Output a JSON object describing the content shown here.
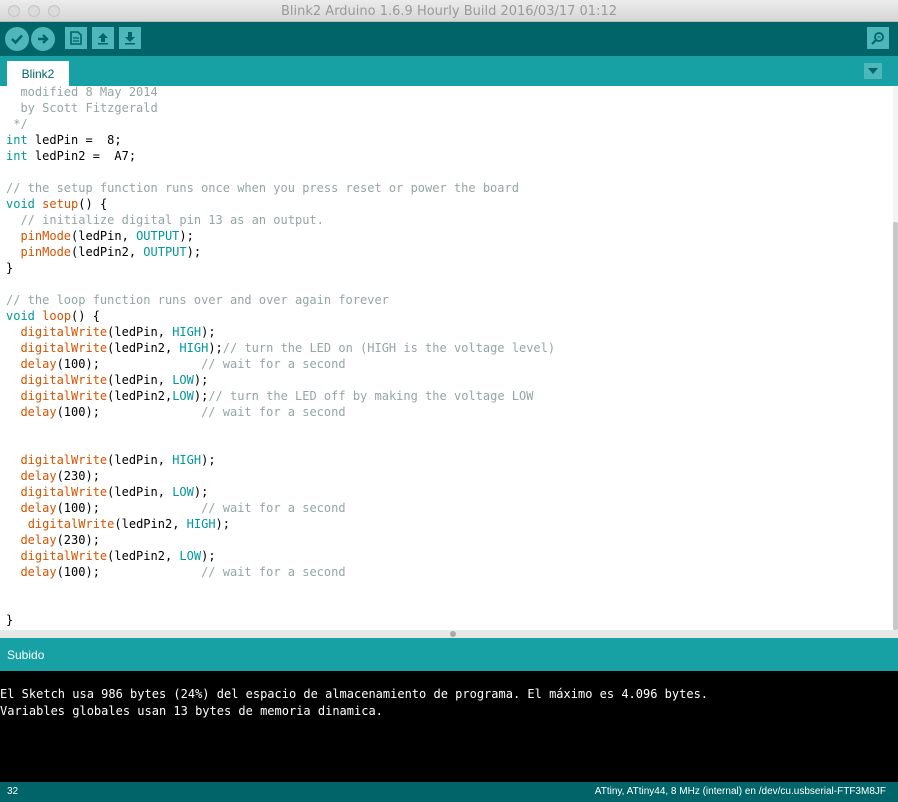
{
  "window": {
    "title": "Blink2 Arduino 1.6.9 Hourly Build 2016/03/17 01:12"
  },
  "toolbar": {
    "verify_icon": "check-icon",
    "upload_icon": "arrow-right-icon",
    "new_icon": "document-icon",
    "open_icon": "upload-icon",
    "save_icon": "download-icon",
    "serial_monitor_icon": "magnifier-icon"
  },
  "tabs": [
    {
      "label": "Blink2"
    }
  ],
  "editor": {
    "lines": [
      [
        {
          "t": "  modified 8 May 2014",
          "c": "com"
        }
      ],
      [
        {
          "t": "  by Scott Fitzgerald",
          "c": "com"
        }
      ],
      [
        {
          "t": " */",
          "c": "com"
        }
      ],
      [
        {
          "t": "int",
          "c": "kw"
        },
        {
          "t": " ledPin =  8;"
        }
      ],
      [
        {
          "t": "int",
          "c": "kw"
        },
        {
          "t": " ledPin2 =  A7;"
        }
      ],
      [],
      [
        {
          "t": "// the setup function runs once when you press reset or power the board",
          "c": "com"
        }
      ],
      [
        {
          "t": "void",
          "c": "kw"
        },
        {
          "t": " "
        },
        {
          "t": "setup",
          "c": "fn"
        },
        {
          "t": "() {"
        }
      ],
      [
        {
          "t": "  // initialize digital pin 13 as an output.",
          "c": "com"
        }
      ],
      [
        {
          "t": "  "
        },
        {
          "t": "pinMode",
          "c": "fn"
        },
        {
          "t": "(ledPin, "
        },
        {
          "t": "OUTPUT",
          "c": "kw"
        },
        {
          "t": ");"
        }
      ],
      [
        {
          "t": "  "
        },
        {
          "t": "pinMode",
          "c": "fn"
        },
        {
          "t": "(ledPin2, "
        },
        {
          "t": "OUTPUT",
          "c": "kw"
        },
        {
          "t": ");"
        }
      ],
      [
        {
          "t": "}"
        }
      ],
      [],
      [
        {
          "t": "// the loop function runs over and over again forever",
          "c": "com"
        }
      ],
      [
        {
          "t": "void",
          "c": "kw"
        },
        {
          "t": " "
        },
        {
          "t": "loop",
          "c": "fn"
        },
        {
          "t": "() {"
        }
      ],
      [
        {
          "t": "  "
        },
        {
          "t": "digitalWrite",
          "c": "fn"
        },
        {
          "t": "(ledPin, "
        },
        {
          "t": "HIGH",
          "c": "kw"
        },
        {
          "t": ");"
        }
      ],
      [
        {
          "t": "  "
        },
        {
          "t": "digitalWrite",
          "c": "fn"
        },
        {
          "t": "(ledPin2, "
        },
        {
          "t": "HIGH",
          "c": "kw"
        },
        {
          "t": ");"
        },
        {
          "t": "// turn the LED on (HIGH is the voltage level)",
          "c": "com"
        }
      ],
      [
        {
          "t": "  "
        },
        {
          "t": "delay",
          "c": "fn"
        },
        {
          "t": "(100);              "
        },
        {
          "t": "// wait for a second",
          "c": "com"
        }
      ],
      [
        {
          "t": "  "
        },
        {
          "t": "digitalWrite",
          "c": "fn"
        },
        {
          "t": "(ledPin, "
        },
        {
          "t": "LOW",
          "c": "kw"
        },
        {
          "t": ");"
        }
      ],
      [
        {
          "t": "  "
        },
        {
          "t": "digitalWrite",
          "c": "fn"
        },
        {
          "t": "(ledPin2,"
        },
        {
          "t": "LOW",
          "c": "kw"
        },
        {
          "t": ");"
        },
        {
          "t": "// turn the LED off by making the voltage LOW",
          "c": "com"
        }
      ],
      [
        {
          "t": "  "
        },
        {
          "t": "delay",
          "c": "fn"
        },
        {
          "t": "(100);              "
        },
        {
          "t": "// wait for a second",
          "c": "com"
        }
      ],
      [],
      [],
      [
        {
          "t": "  "
        },
        {
          "t": "digitalWrite",
          "c": "fn"
        },
        {
          "t": "(ledPin, "
        },
        {
          "t": "HIGH",
          "c": "kw"
        },
        {
          "t": ");"
        }
      ],
      [
        {
          "t": "  "
        },
        {
          "t": "delay",
          "c": "fn"
        },
        {
          "t": "(230);"
        }
      ],
      [
        {
          "t": "  "
        },
        {
          "t": "digitalWrite",
          "c": "fn"
        },
        {
          "t": "(ledPin, "
        },
        {
          "t": "LOW",
          "c": "kw"
        },
        {
          "t": ");"
        }
      ],
      [
        {
          "t": "  "
        },
        {
          "t": "delay",
          "c": "fn"
        },
        {
          "t": "(100);              "
        },
        {
          "t": "// wait for a second",
          "c": "com"
        }
      ],
      [
        {
          "t": "   "
        },
        {
          "t": "digitalWrite",
          "c": "fn"
        },
        {
          "t": "(ledPin2, "
        },
        {
          "t": "HIGH",
          "c": "kw"
        },
        {
          "t": ");"
        }
      ],
      [
        {
          "t": "  "
        },
        {
          "t": "delay",
          "c": "fn"
        },
        {
          "t": "(230);"
        }
      ],
      [
        {
          "t": "  "
        },
        {
          "t": "digitalWrite",
          "c": "fn"
        },
        {
          "t": "(ledPin2, "
        },
        {
          "t": "LOW",
          "c": "kw"
        },
        {
          "t": ");"
        }
      ],
      [
        {
          "t": "  "
        },
        {
          "t": "delay",
          "c": "fn"
        },
        {
          "t": "(100);              "
        },
        {
          "t": "// wait for a second",
          "c": "com"
        }
      ],
      [],
      [],
      [
        {
          "t": "}"
        }
      ]
    ]
  },
  "status": {
    "message": "Subido"
  },
  "console": {
    "lines": [
      "El Sketch usa 986 bytes (24%) del espacio de almacenamiento de programa. El máximo es 4.096 bytes.",
      "Variables globales usan 13 bytes de memoria dinamica."
    ]
  },
  "footer": {
    "line_number": "32",
    "board_info": "ATtiny, ATtiny44, 8 MHz (internal) en /dev/cu.usbserial-FTF3M8JF"
  },
  "colors": {
    "toolbar": "#006468",
    "tabbar": "#17a1a5",
    "keyword": "#00979c",
    "function": "#d35400",
    "comment": "#95a5a6"
  }
}
